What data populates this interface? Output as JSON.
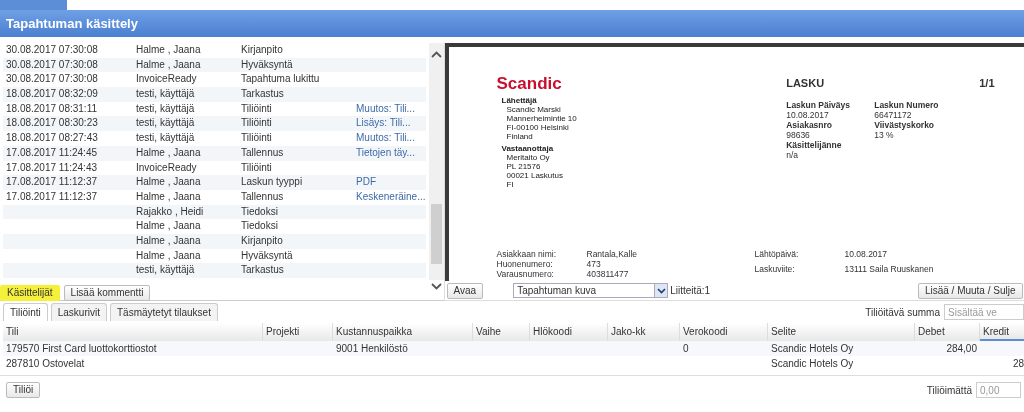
{
  "header": {
    "title": "Tapahtuman käsittely"
  },
  "events": [
    {
      "time": "30.08.2017 07:30:08",
      "user": "Halme , Jaana",
      "action": "Kirjanpito"
    },
    {
      "time": "30.08.2017 07:30:08",
      "user": "Halme , Jaana",
      "action": "Hyväksyntä"
    },
    {
      "time": "30.08.2017 07:30:08",
      "user": "InvoiceReady",
      "action": "Tapahtuma lukittu"
    },
    {
      "time": "18.08.2017 08:32:09",
      "user": "testi, käyttäjä",
      "action": "Tarkastus"
    },
    {
      "time": "18.08.2017 08:31:11",
      "user": "testi, käyttäjä",
      "action": "Tiliöinti",
      "detail": "Muutos: Tili..."
    },
    {
      "time": "18.08.2017 08:30:23",
      "user": "testi, käyttäjä",
      "action": "Tiliöinti",
      "detail": "Lisäys: Tili..."
    },
    {
      "time": "18.08.2017 08:27:43",
      "user": "testi, käyttäjä",
      "action": "Tiliöinti",
      "detail": "Muutos: Tili..."
    },
    {
      "time": "17.08.2017 11:24:45",
      "user": "Halme , Jaana",
      "action": "Tallennus",
      "detail": "Tietojen täy..."
    },
    {
      "time": "17.08.2017 11:24:43",
      "user": "InvoiceReady",
      "action": "Tiliöinti"
    },
    {
      "time": "17.08.2017 11:12:37",
      "user": "Halme , Jaana",
      "action": "Laskun tyyppi",
      "detail": "PDF"
    },
    {
      "time": "17.08.2017 11:12:37",
      "user": "Halme , Jaana",
      "action": "Tallennus",
      "detail": "Keskeneräine..."
    },
    {
      "user": "Rajakko , Heidi",
      "action": "Tiedoksi"
    },
    {
      "user": "Halme , Jaana",
      "action": "Tiedoksi"
    },
    {
      "user": "Halme , Jaana",
      "action": "Kirjanpito"
    },
    {
      "user": "Halme , Jaana",
      "action": "Hyväksyntä"
    },
    {
      "user": "testi, käyttäjä",
      "action": "Tarkastus"
    }
  ],
  "event_buttons": [
    {
      "label": "Käsittelijät",
      "highlighted": true
    },
    {
      "label": "Lisää kommentti",
      "highlighted": false
    }
  ],
  "invoice": {
    "logo": "Scandic",
    "sender_label": "Lähettäjä",
    "sender_lines": [
      "Scandic Marski",
      "Mannerheimintie 10",
      "FI-00100 Helsinki",
      "Finland"
    ],
    "recipient_label": "Vastaanottaja",
    "recipient_lines": [
      "Meritaito Oy",
      "PL 21576",
      "00021 Laskutus",
      "FI"
    ],
    "title": "LASKU",
    "page": "1/1",
    "fields": [
      {
        "label": "Laskun Päiväys",
        "value": "10.08.2017"
      },
      {
        "label": "Laskun Numero",
        "value": "66471172"
      },
      {
        "label": "Asiakasnro",
        "value": "98636"
      },
      {
        "label": "Viivästyskorko",
        "value": "13 %"
      },
      {
        "label": "Käsittelijänne",
        "value": "n/a"
      }
    ],
    "footer_left": [
      {
        "label": "Asiakkaan nimi:",
        "value": "Rantala,Kalle"
      },
      {
        "label": "Huonenumero:",
        "value": "473"
      },
      {
        "label": "Varausnumero:",
        "value": "403811477"
      }
    ],
    "footer_right": [
      {
        "label": "Lähtöpäivä:",
        "value": "10.08.2017"
      },
      {
        "label": "Laskuviite:",
        "value": "13111 Saila Ruuskanen"
      }
    ]
  },
  "preview_toolbar": {
    "open_button": "Avaa",
    "attachment_select": "Tapahtuman kuva",
    "attachments": "Liitteitä:1",
    "manage_button": "Lisää / Muuta / Sulje"
  },
  "tabs": [
    {
      "label": "Tiliöinti",
      "selected": true
    },
    {
      "label": "Laskurivit",
      "selected": false
    },
    {
      "label": "Täsmäytetyt tilaukset",
      "selected": false
    }
  ],
  "sum_field": {
    "label": "Tiliöitävä summa",
    "placeholder": "Sisältää ve"
  },
  "table": {
    "columns": [
      {
        "label": "Tili",
        "active": false
      },
      {
        "label": "Projekti",
        "active": false
      },
      {
        "label": "Kustannuspaikka",
        "active": false
      },
      {
        "label": "Vaihe",
        "active": false
      },
      {
        "label": "Hlökoodi",
        "active": false
      },
      {
        "label": "Jako-kk",
        "active": false
      },
      {
        "label": "Verokoodi",
        "active": false
      },
      {
        "label": "Selite",
        "active": false
      },
      {
        "label": "Debet",
        "active": false
      },
      {
        "label": "Kredit",
        "active": true
      }
    ],
    "rows": [
      [
        "179570 First Card luottokorttiostot",
        null,
        "9001 Henkilöstö",
        null,
        null,
        null,
        "0",
        "Scandic Hotels Oy",
        "284,00",
        null
      ],
      [
        "287810 Ostovelat",
        null,
        null,
        null,
        null,
        null,
        null,
        "Scandic Hotels Oy",
        null,
        "28"
      ]
    ]
  },
  "post_button": "Tiliöi",
  "unposted": {
    "label": "Tiliöimättä",
    "placeholder": "0,00"
  }
}
